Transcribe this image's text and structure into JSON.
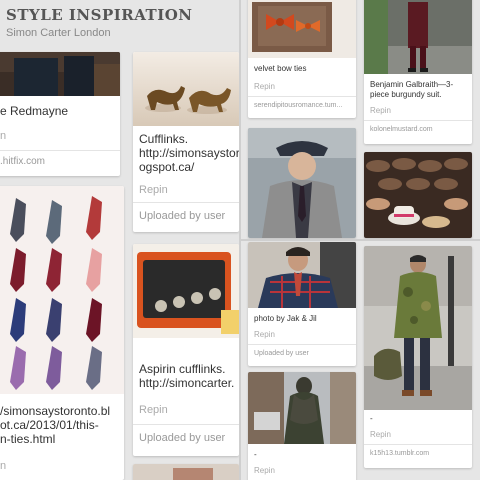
{
  "board": {
    "title": "STYLE INSPIRATION",
    "owner": "Simon Carter London"
  },
  "pins": {
    "redmayne": {
      "description": "e Redmayne",
      "repin": "n",
      "source": ".hitfix.com"
    },
    "cufflinks_dogs": {
      "description": "Cufflinks.\nhttp://simonsaystor\nogspot.ca/",
      "repin": "Repin",
      "source": "Uploaded by user"
    },
    "ties": {
      "description": "/simonsaystoronto.bl\not.ca/2013/01/this-\nn-ties.html",
      "repin": "n"
    },
    "aspirin": {
      "description": "Aspirin cufflinks.\nhttp://simoncarter.",
      "repin": "Repin",
      "source": "Uploaded by user"
    },
    "velvet_bow": {
      "description": "velvet bow ties",
      "repin": "Repin",
      "source": "serendipitousromance.tum..."
    },
    "burgundy": {
      "description": "Benjamin Galbraith—3-\npiece burgundy suit.",
      "repin": "Repin",
      "source": "kolonelmustard.com"
    },
    "jak_jil": {
      "description": "photo by Jak & Jil",
      "repin": "Repin",
      "source": "Uploaded by user"
    },
    "camo": {
      "description": "-",
      "repin": "Repin",
      "source": "k15h13.tumblr.com"
    },
    "scarf_man": {
      "description": "-",
      "repin": "Repin"
    }
  }
}
